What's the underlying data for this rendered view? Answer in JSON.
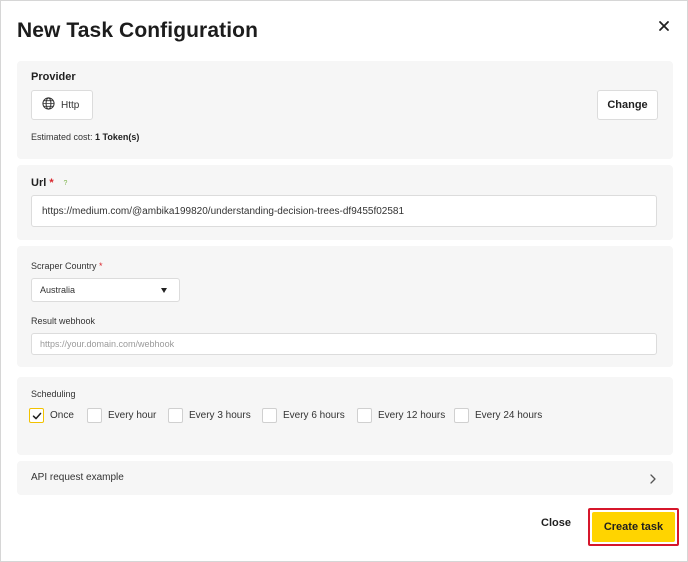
{
  "dialog": {
    "title": "New Task Configuration",
    "close_icon": "close-icon"
  },
  "provider": {
    "label": "Provider",
    "chip_icon": "globe-icon",
    "chip_label": "Http",
    "change_label": "Change",
    "cost_prefix": "Estimated cost:",
    "cost_value": "1 Token(s)"
  },
  "url": {
    "label": "Url",
    "required_mark": "*",
    "help_icon": "?",
    "value": "https://medium.com/@ambika199820/understanding-decision-trees-df9455f02581"
  },
  "scraper_country": {
    "label": "Scraper Country",
    "required_mark": "*",
    "selected": "Australia"
  },
  "webhook": {
    "label": "Result webhook",
    "placeholder": "https://your.domain.com/webhook"
  },
  "scheduling": {
    "label": "Scheduling",
    "options": [
      {
        "label": "Once",
        "checked": true
      },
      {
        "label": "Every hour",
        "checked": false
      },
      {
        "label": "Every 3 hours",
        "checked": false
      },
      {
        "label": "Every 6 hours",
        "checked": false
      },
      {
        "label": "Every 12 hours",
        "checked": false
      },
      {
        "label": "Every 24 hours",
        "checked": false
      }
    ]
  },
  "api_example": {
    "label": "API request example"
  },
  "footer": {
    "close_label": "Close",
    "create_label": "Create task"
  },
  "colors": {
    "accent": "#ffd400",
    "highlight_border": "#d6162b",
    "required": "#d9262c",
    "section_bg": "#f6f6f6"
  }
}
